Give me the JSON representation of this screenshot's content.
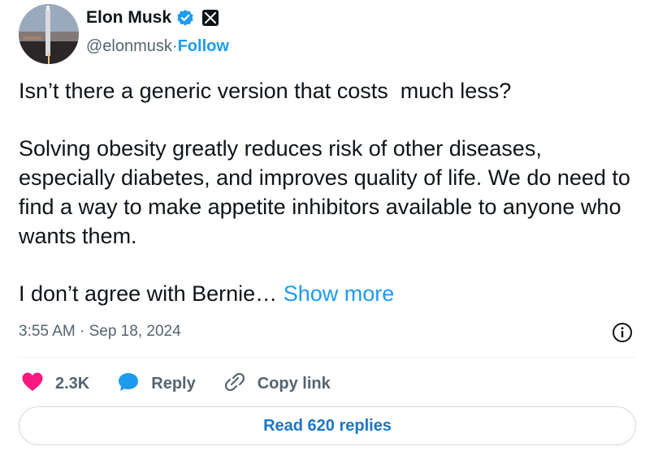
{
  "author": {
    "display_name": "Elon Musk",
    "handle": "@elonmusk",
    "separator": " · ",
    "follow_label": "Follow"
  },
  "tweet": {
    "paragraph_1": "Isn’t there a generic version that costs  much less?",
    "paragraph_2": "Solving obesity greatly reduces risk of other diseases, especially diabetes, and improves quality of life. We do need to find a way to make appetite inhibitors available to anyone who wants them.",
    "paragraph_3": "I don’t agree with Bernie… ",
    "show_more_label": "Show more"
  },
  "meta": {
    "timestamp": "3:55 AM · Sep 18, 2024"
  },
  "actions": {
    "like_count": "2.3K",
    "reply_label": "Reply",
    "copy_link_label": "Copy link"
  },
  "footer": {
    "read_replies_label": "Read 620 replies"
  },
  "colors": {
    "accent": "#1d9bf0",
    "like": "#f91880",
    "muted": "#536471",
    "text": "#0f1419"
  }
}
